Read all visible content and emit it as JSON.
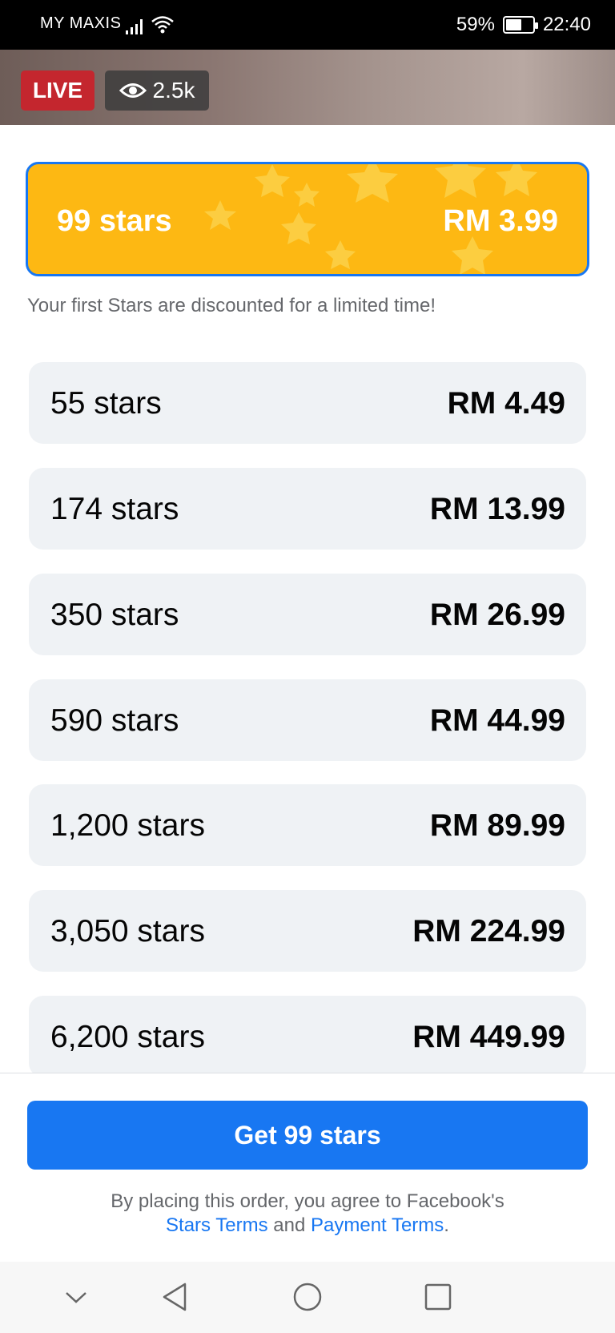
{
  "status_bar": {
    "carrier": "MY MAXIS",
    "battery_percent": "59%",
    "battery_level": 0.59,
    "time": "22:40",
    "icons": [
      "signal-icon",
      "wifi-icon",
      "battery-icon"
    ]
  },
  "video": {
    "live_label": "LIVE",
    "viewers": "2.5k",
    "viewer_icon": "eye-icon"
  },
  "featured_offer": {
    "label": "99 stars",
    "price": "RM 3.99",
    "note": "Your first Stars are discounted for a limited time!"
  },
  "offers": [
    {
      "label": "55 stars",
      "price": "RM 4.49"
    },
    {
      "label": "174 stars",
      "price": "RM 13.99"
    },
    {
      "label": "350 stars",
      "price": "RM 26.99"
    },
    {
      "label": "590 stars",
      "price": "RM 44.99"
    },
    {
      "label": "1,200 stars",
      "price": "RM 89.99"
    },
    {
      "label": "3,050 stars",
      "price": "RM 224.99"
    },
    {
      "label": "6,200 stars",
      "price": "RM 449.99"
    }
  ],
  "footer": {
    "buy_label": "Get 99 stars",
    "terms_prefix": "By placing this order, you agree to Facebook's",
    "stars_terms": "Stars Terms",
    "terms_and": "and",
    "payment_terms": "Payment Terms",
    "terms_suffix": "."
  },
  "nav_bar": {
    "icons": [
      "chevron-down-icon",
      "back-icon",
      "home-icon",
      "recents-icon"
    ]
  },
  "colors": {
    "accent": "#1877f2",
    "featured_bg": "#fdb813",
    "live_red": "#c4262e",
    "offer_bg": "#eff2f5"
  }
}
